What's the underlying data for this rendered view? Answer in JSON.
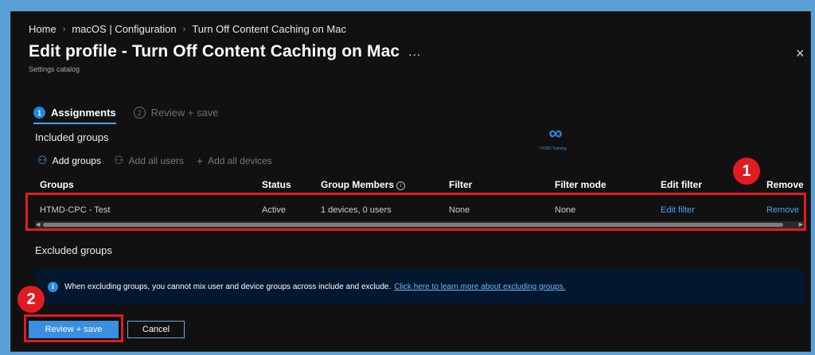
{
  "breadcrumb": [
    "Home",
    "macOS | Configuration",
    "Turn Off Content Caching on Mac"
  ],
  "header": {
    "title": "Edit profile - Turn Off Content Caching on Mac",
    "subtitle": "Settings catalog",
    "more": "...",
    "close": "×"
  },
  "steps": [
    {
      "num": "1",
      "label": "Assignments",
      "state": "active"
    },
    {
      "num": "2",
      "label": "Review + save",
      "state": "inactive"
    }
  ],
  "included": {
    "heading": "Included groups",
    "toolbar": [
      {
        "icon": "person-icon",
        "glyph": "⚇",
        "label": "Add groups",
        "enabled": true
      },
      {
        "icon": "people-icon",
        "glyph": "⚇",
        "label": "Add all users",
        "enabled": false
      },
      {
        "icon": "plus-icon",
        "glyph": "+",
        "label": "Add all devices",
        "enabled": false
      }
    ],
    "columns": [
      "Groups",
      "Status",
      "Group Members",
      "Filter",
      "Filter mode",
      "Edit filter",
      "Remove"
    ],
    "rows": [
      {
        "group": "HTMD-CPC - Test",
        "status": "Active",
        "members": "1 devices, 0 users",
        "filter": "None",
        "filter_mode": "None",
        "edit_filter": "Edit filter",
        "remove": "Remove"
      }
    ]
  },
  "excluded": {
    "heading": "Excluded groups",
    "info_text": "When excluding groups, you cannot mix user and device groups across include and exclude.",
    "info_link": "Click here to learn more about excluding groups."
  },
  "logo": {
    "text": "HTMD Training"
  },
  "annotations": {
    "badge1": "1",
    "badge2": "2"
  },
  "buttons": {
    "primary": "Review + save",
    "secondary": "Cancel"
  },
  "colors": {
    "accent": "#1e88e5",
    "highlight": "#e21b22",
    "background": "#5aa0d6",
    "panel": "#111111"
  }
}
